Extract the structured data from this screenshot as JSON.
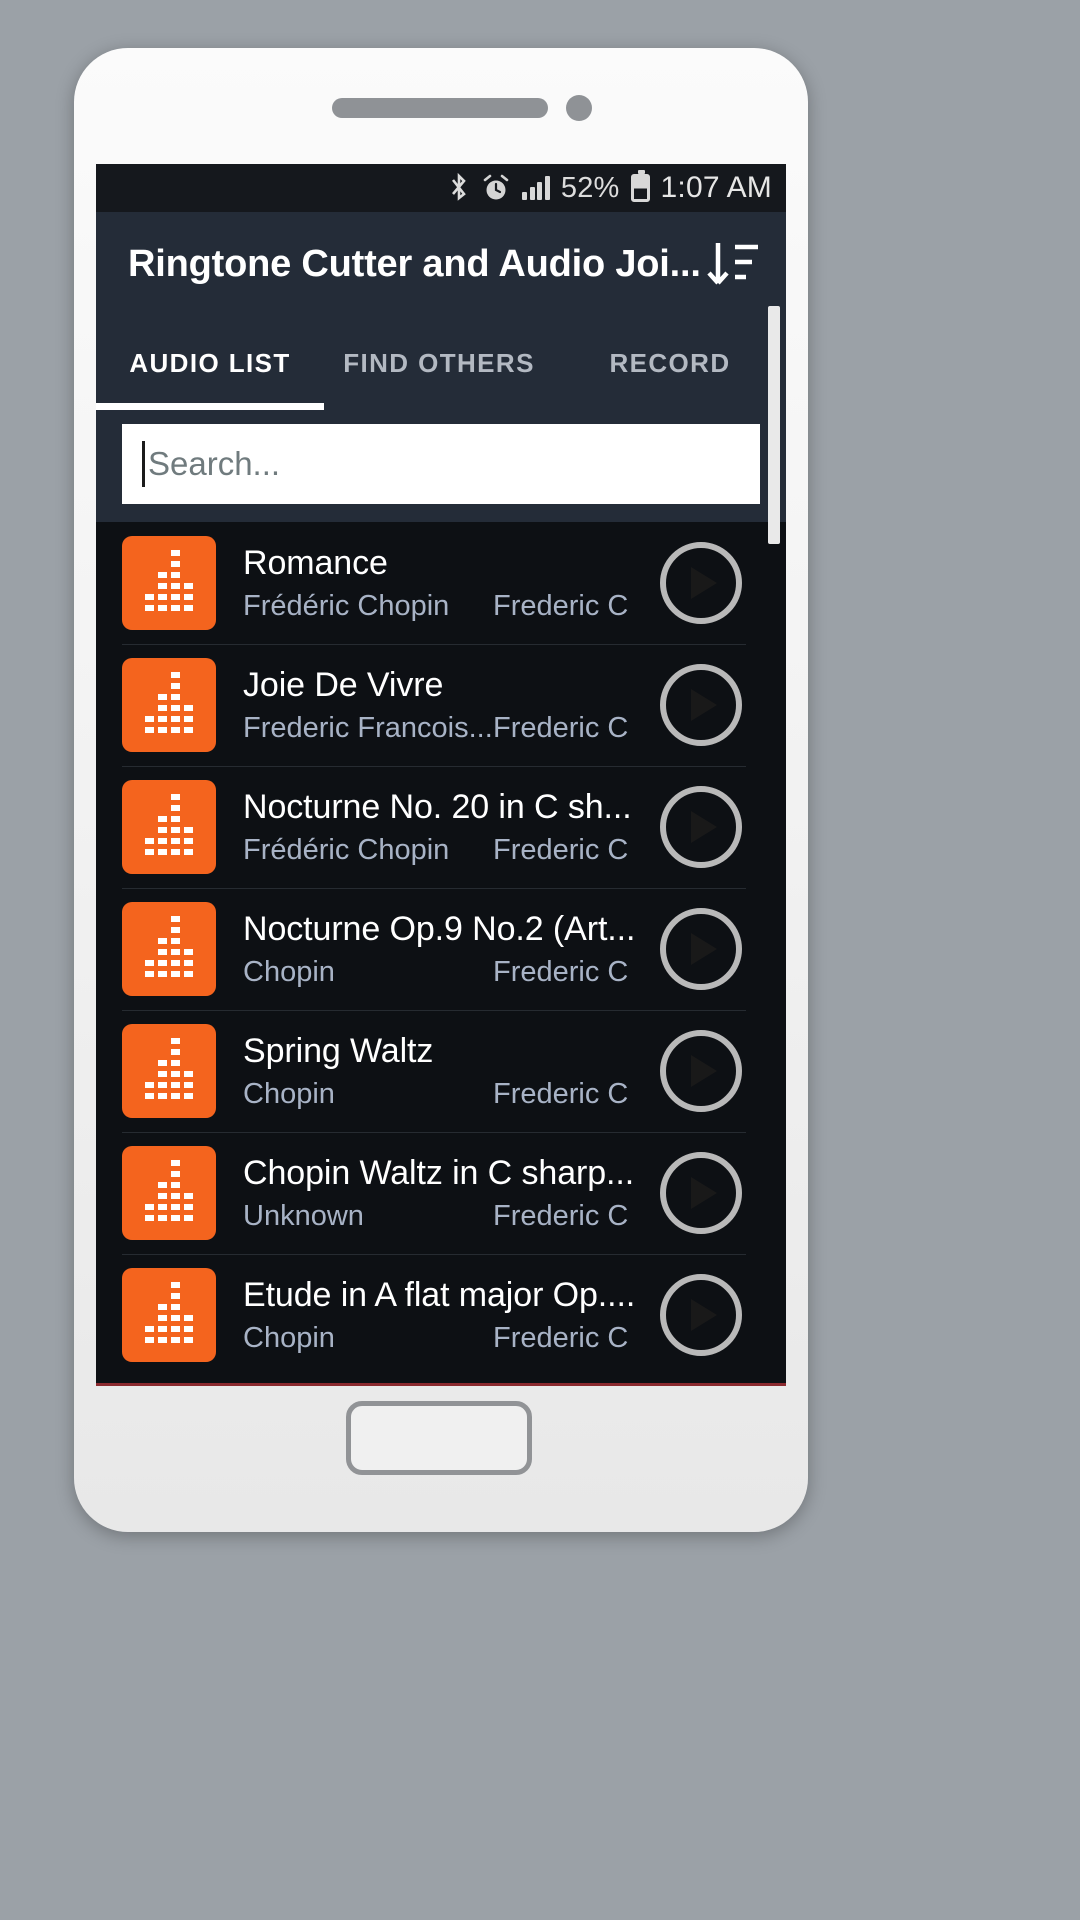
{
  "status_bar": {
    "icons": [
      "bluetooth-icon",
      "alarm-icon",
      "signal-icon",
      "battery-icon"
    ],
    "battery_percent": "52%",
    "time": "1:07 AM"
  },
  "app_bar": {
    "title": "Ringtone Cutter and Audio Joi...",
    "sort_icon": "sort-descending-icon"
  },
  "tabs": [
    {
      "label": "AUDIO LIST",
      "active": true
    },
    {
      "label": "FIND OTHERS",
      "active": false
    },
    {
      "label": "RECORD",
      "active": false
    }
  ],
  "search": {
    "placeholder": "Search...",
    "value": ""
  },
  "colors": {
    "accent_orange": "#f4641e",
    "app_bar": "#242c38",
    "screen_bg": "#0d1014",
    "subtitle": "#a8b3c6"
  },
  "audio_list": [
    {
      "title": "Romance",
      "artist": "Frédéric Chopin",
      "album": "Frederic C",
      "thumb": "equalizer-icon",
      "action": "play-icon"
    },
    {
      "title": "Joie De Vivre",
      "artist": "Frederic Francois...",
      "album": "Frederic C",
      "thumb": "equalizer-icon",
      "action": "play-icon"
    },
    {
      "title": "Nocturne No. 20 in C sh...",
      "artist": "Frédéric Chopin",
      "album": "Frederic C",
      "thumb": "equalizer-icon",
      "action": "play-icon"
    },
    {
      "title": "Nocturne Op.9 No.2 (Art...",
      "artist": "Chopin",
      "album": "Frederic C",
      "thumb": "equalizer-icon",
      "action": "play-icon"
    },
    {
      "title": "Spring Waltz",
      "artist": "Chopin",
      "album": "Frederic C",
      "thumb": "equalizer-icon",
      "action": "play-icon"
    },
    {
      "title": "Chopin Waltz in C sharp...",
      "artist": "Unknown",
      "album": "Frederic C",
      "thumb": "equalizer-icon",
      "action": "play-icon"
    },
    {
      "title": "Etude in A flat major Op....",
      "artist": "Chopin",
      "album": "Frederic C",
      "thumb": "equalizer-icon",
      "action": "play-icon"
    }
  ]
}
